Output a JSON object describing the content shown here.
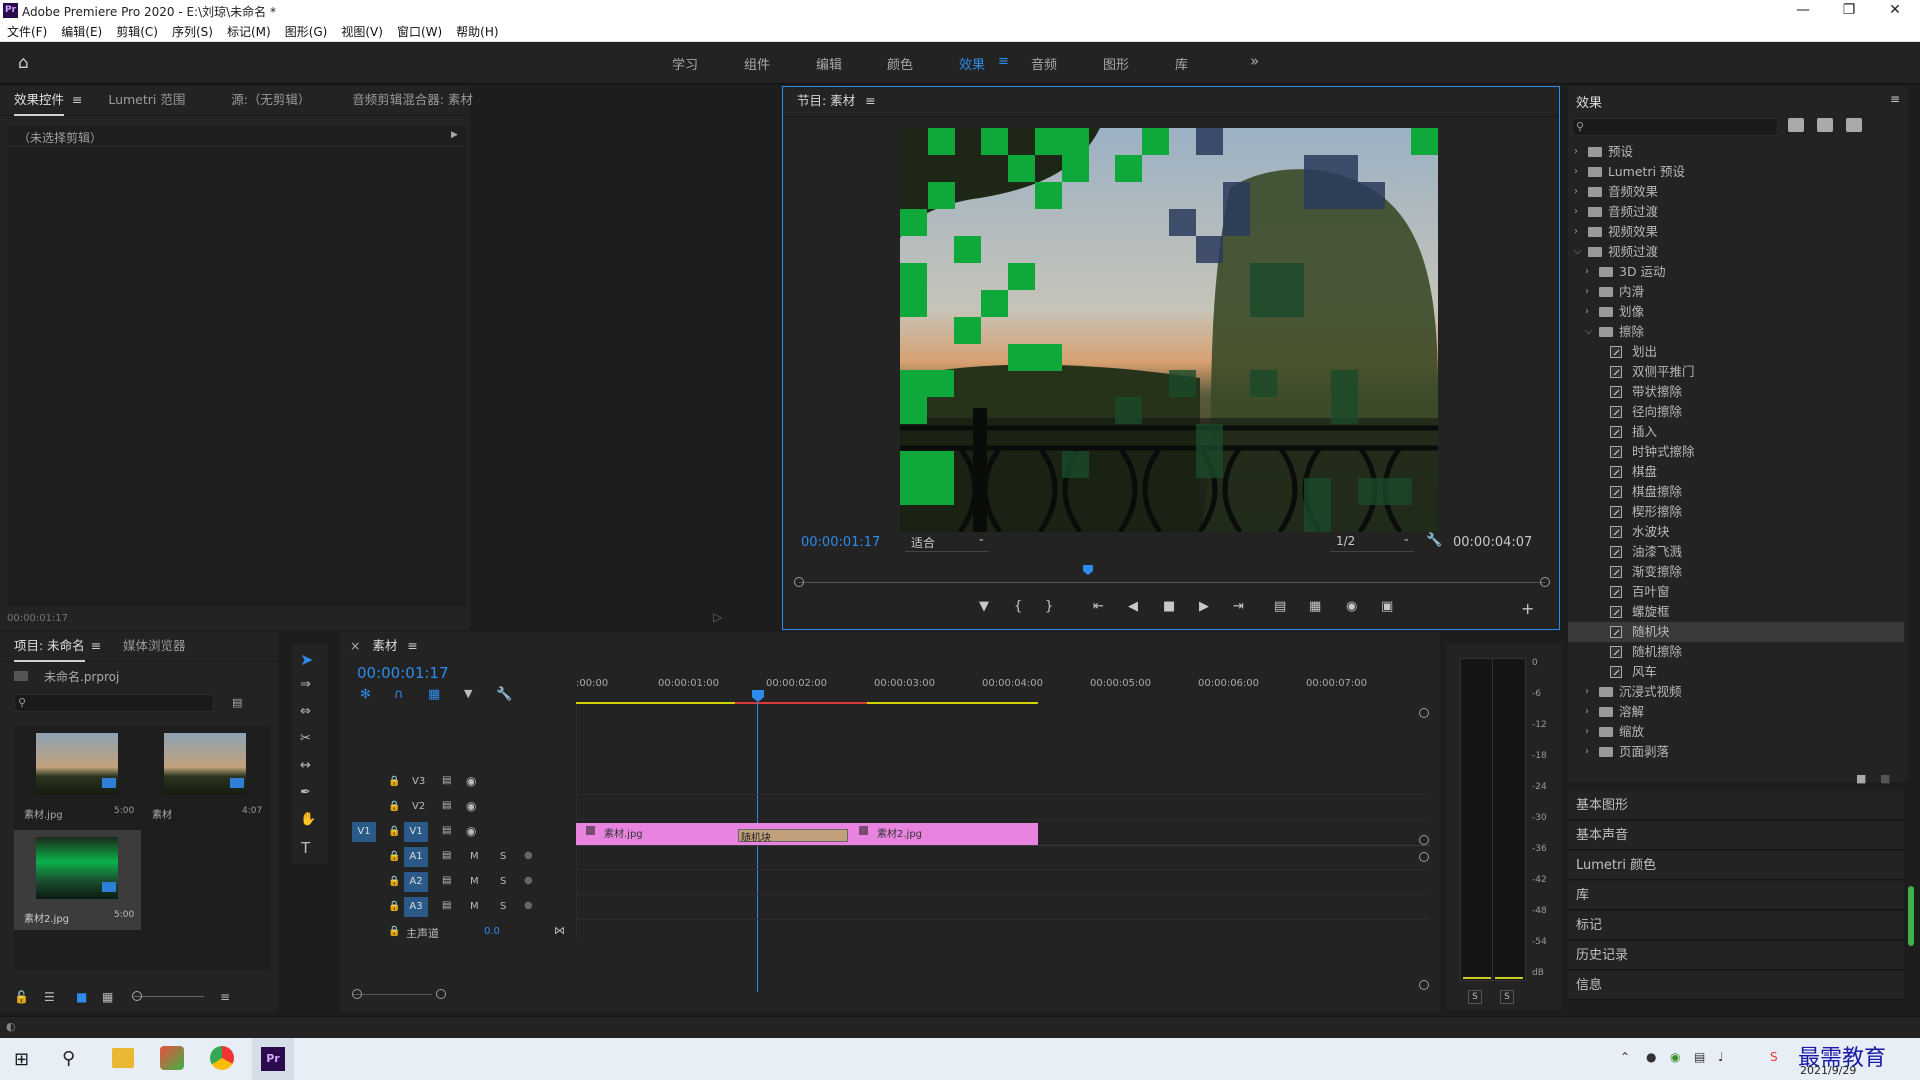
{
  "window": {
    "title": "Adobe Premiere Pro 2020 - E:\\刘琼\\未命名 *",
    "logo": "Pr"
  },
  "menu": [
    "文件(F)",
    "编辑(E)",
    "剪辑(C)",
    "序列(S)",
    "标记(M)",
    "图形(G)",
    "视图(V)",
    "窗口(W)",
    "帮助(H)"
  ],
  "workspaces": [
    "学习",
    "组件",
    "编辑",
    "颜色",
    "效果",
    "音频",
    "图形",
    "库"
  ],
  "workspace_active": "效果",
  "left_panel": {
    "tabs": [
      "效果控件",
      "Lumetri 范围",
      "源:（无剪辑）",
      "音频剪辑混合器: 素材"
    ],
    "no_clip": "（未选择剪辑）",
    "timecode": "00:00:01:17"
  },
  "program": {
    "title": "节目: 素材",
    "timecode": "00:00:01:17",
    "fit": "适合",
    "quality": "1/2",
    "duration": "00:00:04:07"
  },
  "effects": {
    "title": "效果",
    "items": [
      {
        "label": "预设",
        "lvl": 0,
        "type": "folder",
        "open": false
      },
      {
        "label": "Lumetri 预设",
        "lvl": 0,
        "type": "folder",
        "open": false
      },
      {
        "label": "音频效果",
        "lvl": 0,
        "type": "folder",
        "open": false
      },
      {
        "label": "音频过渡",
        "lvl": 0,
        "type": "folder",
        "open": false
      },
      {
        "label": "视频效果",
        "lvl": 0,
        "type": "folder",
        "open": false
      },
      {
        "label": "视频过渡",
        "lvl": 0,
        "type": "folder",
        "open": true
      },
      {
        "label": "3D 运动",
        "lvl": 1,
        "type": "folder",
        "open": false
      },
      {
        "label": "内滑",
        "lvl": 1,
        "type": "folder",
        "open": false
      },
      {
        "label": "划像",
        "lvl": 1,
        "type": "folder",
        "open": false
      },
      {
        "label": "擦除",
        "lvl": 1,
        "type": "folder",
        "open": true
      },
      {
        "label": "划出",
        "lvl": 2,
        "type": "fx"
      },
      {
        "label": "双侧平推门",
        "lvl": 2,
        "type": "fx"
      },
      {
        "label": "带状擦除",
        "lvl": 2,
        "type": "fx"
      },
      {
        "label": "径向擦除",
        "lvl": 2,
        "type": "fx"
      },
      {
        "label": "插入",
        "lvl": 2,
        "type": "fx"
      },
      {
        "label": "时钟式擦除",
        "lvl": 2,
        "type": "fx"
      },
      {
        "label": "棋盘",
        "lvl": 2,
        "type": "fx"
      },
      {
        "label": "棋盘擦除",
        "lvl": 2,
        "type": "fx"
      },
      {
        "label": "楔形擦除",
        "lvl": 2,
        "type": "fx"
      },
      {
        "label": "水波块",
        "lvl": 2,
        "type": "fx"
      },
      {
        "label": "油漆飞溅",
        "lvl": 2,
        "type": "fx"
      },
      {
        "label": "渐变擦除",
        "lvl": 2,
        "type": "fx"
      },
      {
        "label": "百叶窗",
        "lvl": 2,
        "type": "fx"
      },
      {
        "label": "螺旋框",
        "lvl": 2,
        "type": "fx"
      },
      {
        "label": "随机块",
        "lvl": 2,
        "type": "fx",
        "selected": true
      },
      {
        "label": "随机擦除",
        "lvl": 2,
        "type": "fx"
      },
      {
        "label": "风车",
        "lvl": 2,
        "type": "fx"
      },
      {
        "label": "沉浸式视频",
        "lvl": 1,
        "type": "folder",
        "open": false
      },
      {
        "label": "溶解",
        "lvl": 1,
        "type": "folder",
        "open": false
      },
      {
        "label": "缩放",
        "lvl": 1,
        "type": "folder",
        "open": false
      },
      {
        "label": "页面剥落",
        "lvl": 1,
        "type": "folder",
        "open": false
      }
    ]
  },
  "lower_panels": [
    "基本图形",
    "基本声音",
    "Lumetri 颜色",
    "库",
    "标记",
    "历史记录",
    "信息"
  ],
  "project": {
    "tabs": [
      "项目: 未命名",
      "媒体浏览器"
    ],
    "file": "未命名.prproj",
    "items": [
      {
        "name": "素材.jpg",
        "dur": "5:00"
      },
      {
        "name": "素材",
        "dur": "4:07"
      },
      {
        "name": "素材2.jpg",
        "dur": "5:00"
      }
    ]
  },
  "timeline": {
    "tab": "素材",
    "timecode": "00:00:01:17",
    "ruler": [
      ":00:00",
      "00:00:01:00",
      "00:00:02:00",
      "00:00:03:00",
      "00:00:04:00",
      "00:00:05:00",
      "00:00:06:00",
      "00:00:07:00"
    ],
    "video_tracks": [
      "V3",
      "V2",
      "V1"
    ],
    "audio_tracks": [
      "A1",
      "A2",
      "A3"
    ],
    "src_v": "V1",
    "master": "主声道",
    "master_val": "0.0",
    "m": "M",
    "s": "S",
    "clips": {
      "a": "素材.jpg",
      "b": "素材2.jpg",
      "transition": "随机块"
    }
  },
  "meter": {
    "scale": [
      "0",
      "-6",
      "-12",
      "-18",
      "-24",
      "-30",
      "-36",
      "-42",
      "-48",
      "-54",
      "dB"
    ],
    "solo": [
      "S",
      "S"
    ]
  },
  "taskbar": {
    "date": "2021/9/29",
    "watermark": "最需教育"
  }
}
